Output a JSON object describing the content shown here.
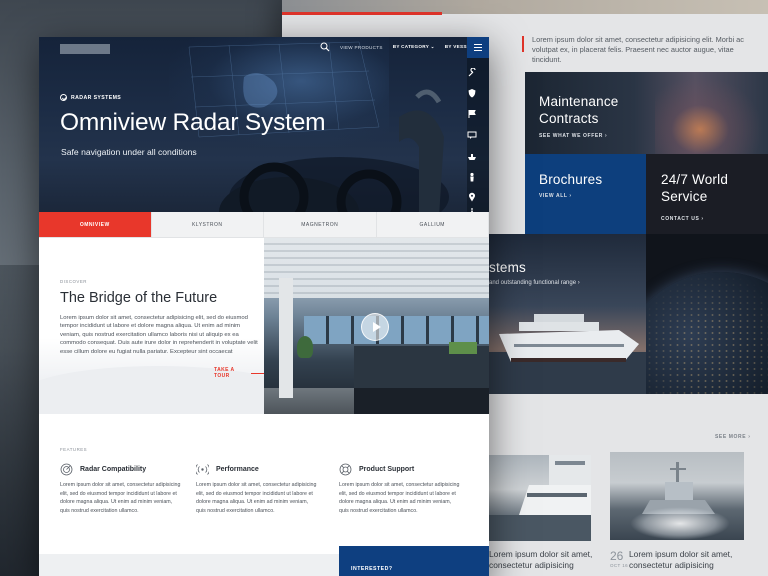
{
  "hero": {
    "nav": {
      "view_products": "VIEW PRODUCTS",
      "by_category": "BY CATEGORY",
      "by_vessel": "BY VESSEL"
    },
    "breadcrumb": "RADAR SYSTEMS",
    "title": "Omniview Radar System",
    "subtitle": "Safe navigation under all conditions",
    "side_icons": [
      "wrench-icon",
      "shield-icon",
      "flag-icon",
      "chat-icon",
      "ship-icon",
      "person-icon",
      "map-pin-icon",
      "more-icon"
    ]
  },
  "tabs": [
    {
      "label": "OMNIVIEW",
      "active": true
    },
    {
      "label": "KLYSTRON",
      "active": false
    },
    {
      "label": "MAGNETRON",
      "active": false
    },
    {
      "label": "GALLIUM",
      "active": false
    }
  ],
  "intro": {
    "eyebrow": "DISCOVER",
    "title": "The Bridge of the Future",
    "body": "Lorem ipsum dolor sit amet, consectetur adipisicing elit, sed do eiusmod tempor incididunt ut labore et dolore magna aliqua. Ut enim ad minim veniam, quis nostrud exercitation ullamco laboris nisi ut aliquip ex ea commodo consequat. Duis aute irure dolor in reprehenderit in voluptate velit esse cillum dolore eu fugiat nulla pariatur. Excepteur sint occaecat",
    "cta": "TAKE A TOUR"
  },
  "features": {
    "eyebrow": "FEATURES",
    "items": [
      {
        "icon": "radar-icon",
        "title": "Radar Compatibility",
        "body": "Lorem ipsum dolor sit amet, consectetur adipisicing elit, sed do eiusmod tempor incididunt ut labore et dolore magna aliqua. Ut enim ad minim veniam, quis nostrud exercitation ullamco."
      },
      {
        "icon": "signal-icon",
        "title": "Performance",
        "body": "Lorem ipsum dolor sit amet, consectetur adipisicing elit, sed do eiusmod tempor incididunt ut labore et dolore magna aliqua. Ut enim ad minim veniam, quis nostrud exercitation ullamco."
      },
      {
        "icon": "lifebuoy-icon",
        "title": "Product Support",
        "body": "Lorem ipsum dolor sit amet, consectetur adipisicing elit, sed do eiusmod tempor incididunt ut labore et dolore magna aliqua. Ut enim ad minim veniam, quis nostrud exercitation ullamco."
      }
    ]
  },
  "interested": "INTERESTED?",
  "right_page": {
    "quote": "Lorem ipsum dolor sit amet, consectetur adipisicing elit. Morbi ac volutpat ex, in placerat felis. Praesent nec auctor augue, vitae tincidunt.",
    "tiles": {
      "maintenance": {
        "title": "Maintenance Contracts",
        "link": "SEE WHAT WE OFFER"
      },
      "brochures": {
        "title": "Brochures",
        "link": "VIEW ALL"
      },
      "world": {
        "title": "24/7 World Service",
        "link": "CONTACT US"
      },
      "systems": {
        "title": "stems",
        "subtitle": "and outstanding functional range"
      }
    },
    "see_more": "SEE MORE",
    "news": [
      {
        "text": "Lorem ipsum dolor sit amet, consectetur adipisicing"
      },
      {
        "date_num": "26",
        "date_mon": "OCT 16",
        "text": "Lorem ipsum dolor sit amet, consectetur adipisicing"
      }
    ]
  },
  "colors": {
    "accent_red": "#e8372b",
    "brand_blue": "#0e3f80"
  }
}
